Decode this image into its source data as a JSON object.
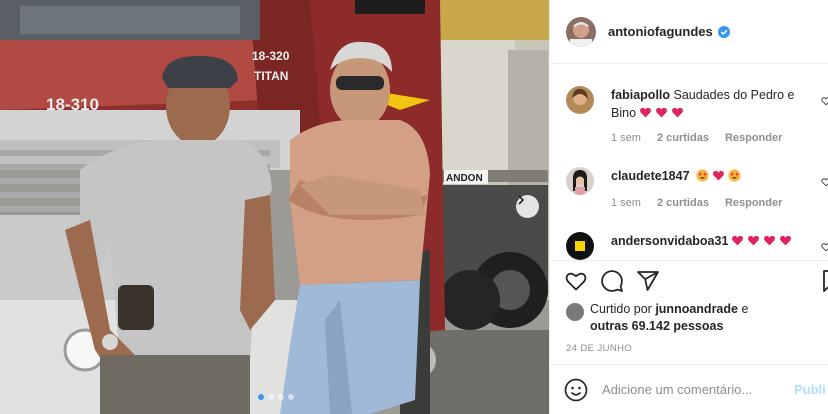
{
  "post": {
    "image_alt": "Dois homens encostados em um caminhão Scania 18-310 Titan",
    "carousel_dots": 4,
    "active_dot": 0,
    "truck_text": {
      "front": "18-310",
      "side_model": "18-320",
      "side_name": "TITAN",
      "trailer": "ANDON"
    }
  },
  "header": {
    "username": "antoniofagundes",
    "verified": true
  },
  "comments": [
    {
      "user": "fabiapollo",
      "text": "Saudades do Pedro e Bino",
      "emoji": [
        "red-heart",
        "red-heart",
        "red-heart"
      ],
      "time": "1 sem",
      "likes": "2 curtidas",
      "reply": "Responder"
    },
    {
      "user": "claudete1847",
      "text": "",
      "emoji": [
        "star-eyes",
        "red-heart",
        "star-eyes"
      ],
      "time": "1 sem",
      "likes": "2 curtidas",
      "reply": "Responder"
    },
    {
      "user": "andersonvidaboa31",
      "text": "",
      "emoji": [
        "red-heart",
        "red-heart",
        "red-heart",
        "red-heart"
      ],
      "time": "",
      "likes": "",
      "reply": ""
    }
  ],
  "actions": {
    "like": "heart-icon",
    "comment": "comment-icon",
    "share": "share-icon",
    "save": "bookmark-icon"
  },
  "likes": {
    "prefix": "Curtido por",
    "user": "junnoandrade",
    "connector": "e",
    "others": "outras 69.142 pessoas"
  },
  "date": "24 DE JUNHO",
  "add_comment": {
    "placeholder": "Adicione um comentário...",
    "publish": "Publi"
  },
  "colors": {
    "accent": "#3897f0",
    "heart": "#ed4956",
    "muted": "#8e8e8e",
    "publish_disabled": "#b2dffc"
  }
}
